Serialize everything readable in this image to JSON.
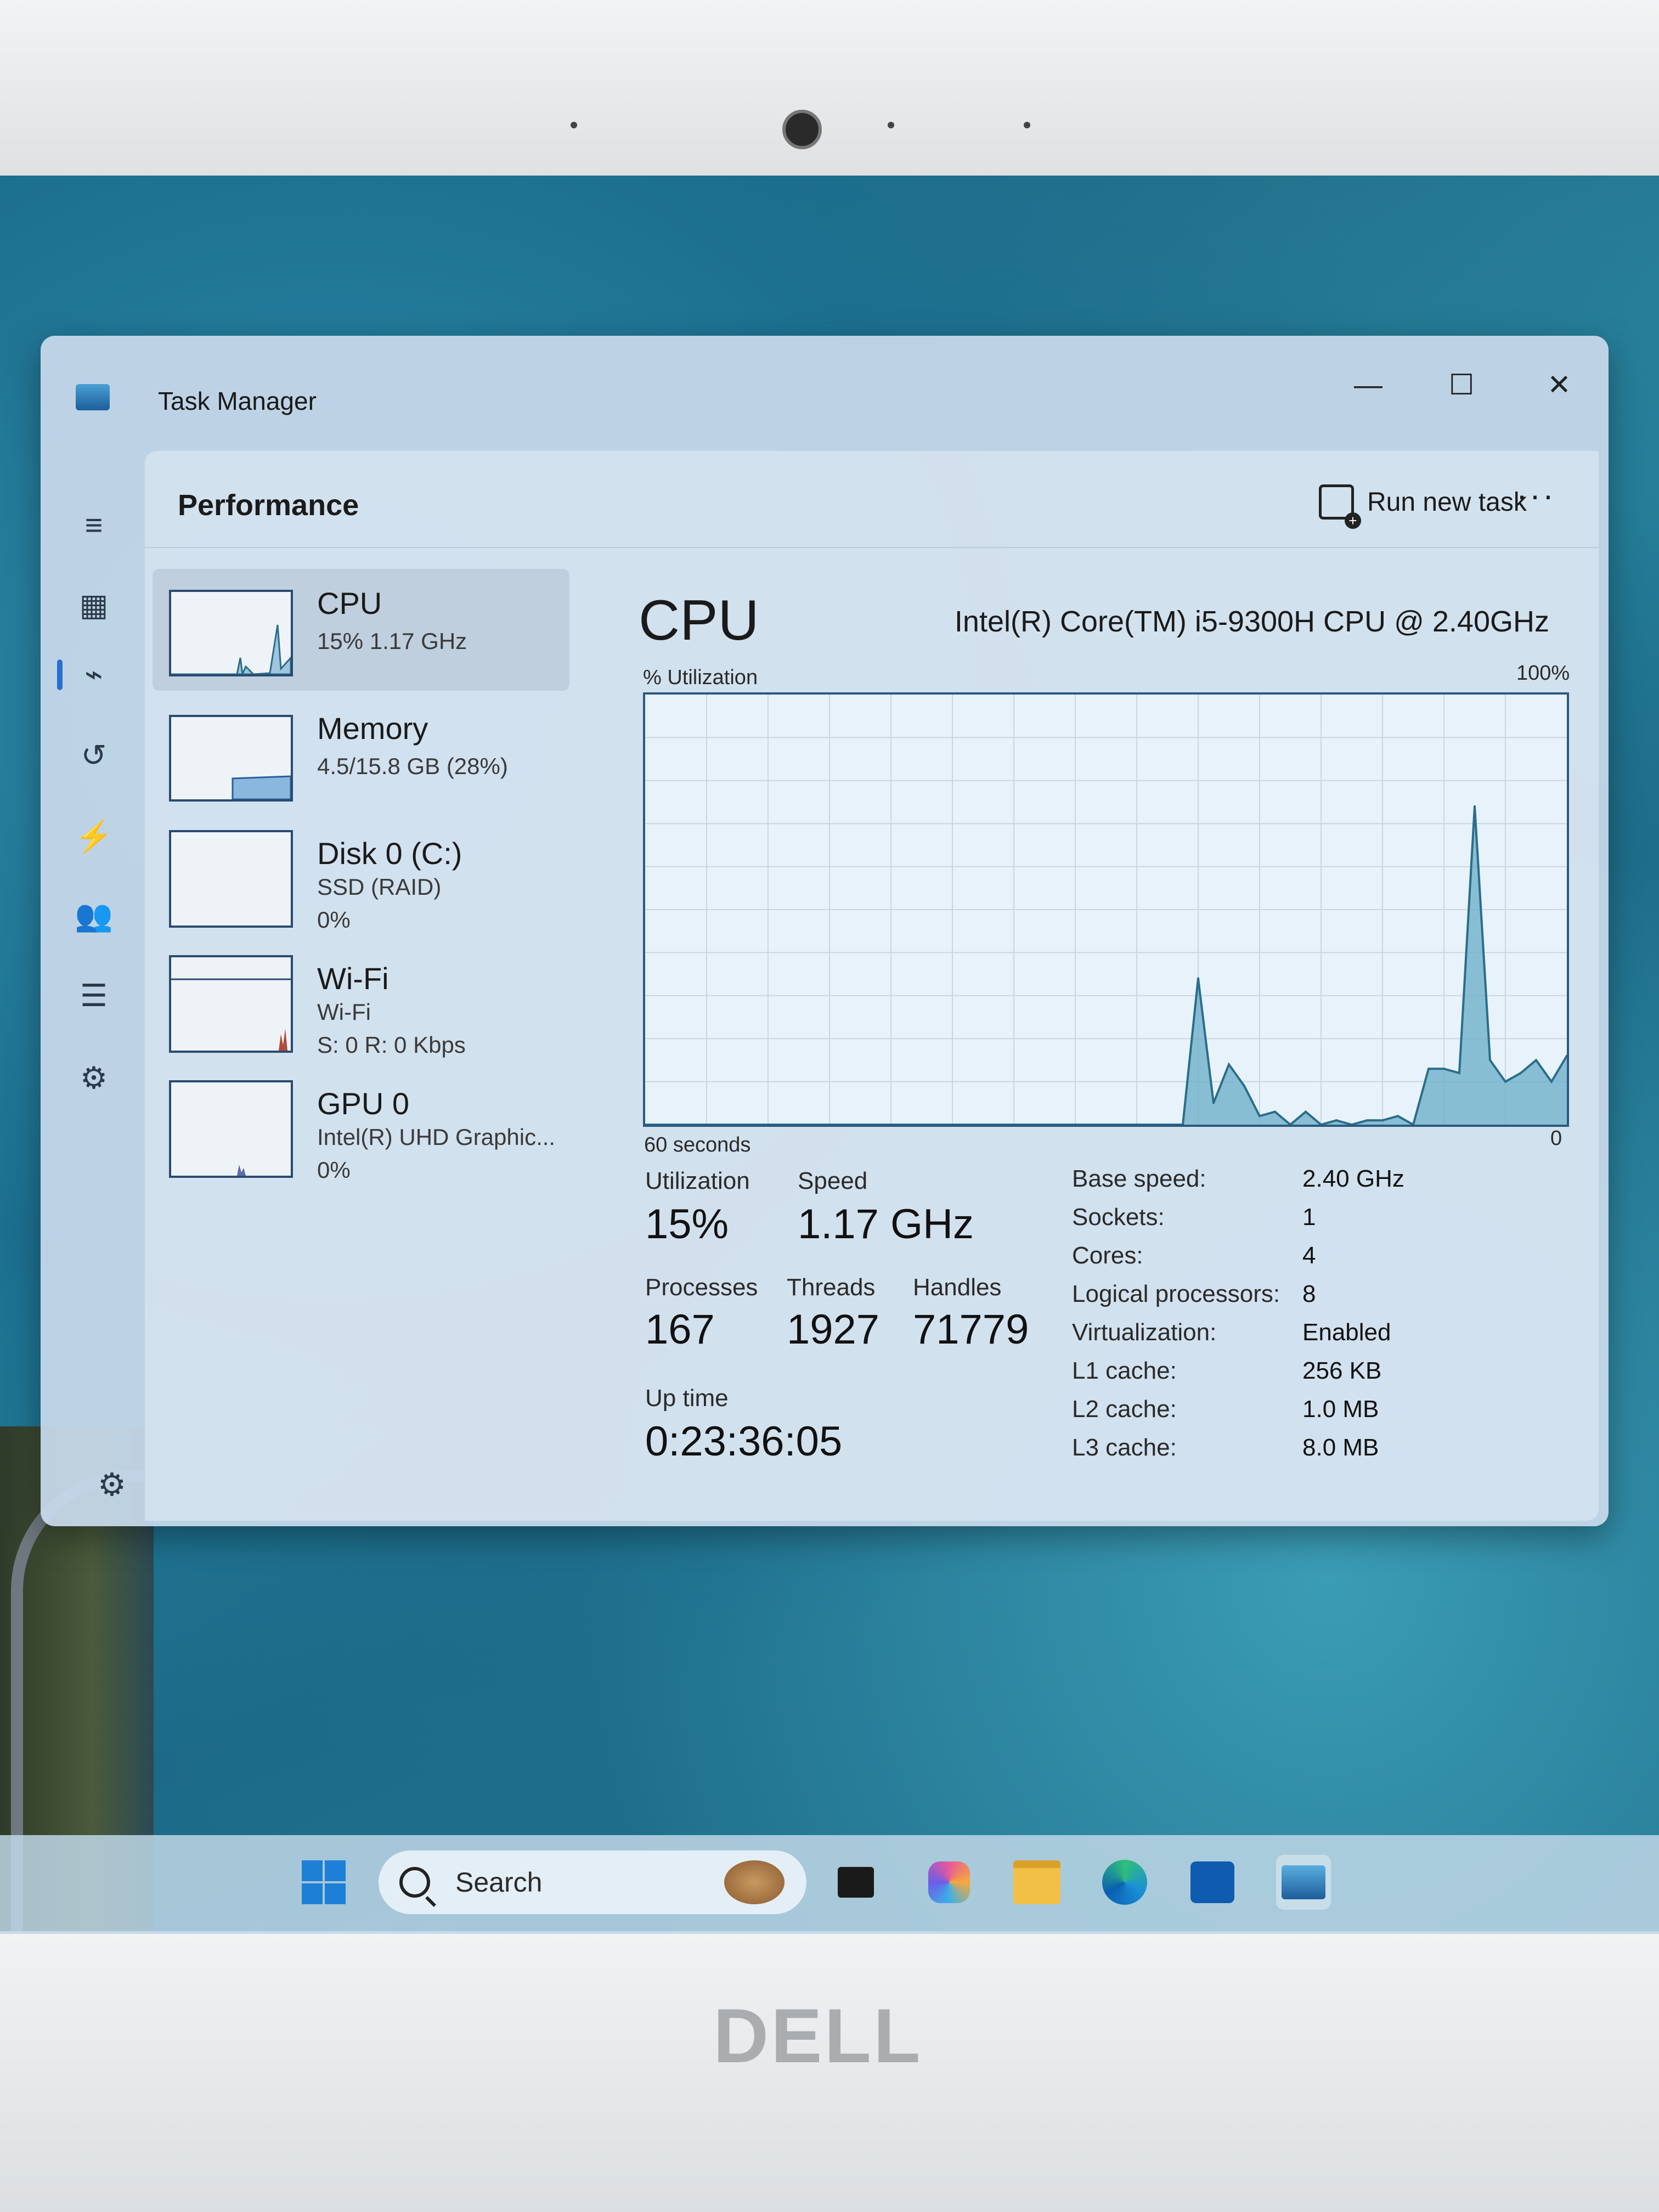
{
  "window": {
    "title": "Task Manager",
    "minimize": "—",
    "maximize": "☐",
    "close": "✕"
  },
  "header": {
    "page_title": "Performance",
    "run_new_task": "Run new task",
    "more": "···"
  },
  "rail": [
    "menu-icon",
    "processes-icon",
    "performance-icon",
    "app-history-icon",
    "startup-icon",
    "users-icon",
    "details-icon",
    "services-icon"
  ],
  "devices": [
    {
      "name": "CPU",
      "line1": "15%  1.17 GHz",
      "line2": ""
    },
    {
      "name": "Memory",
      "line1": "4.5/15.8 GB (28%)",
      "line2": ""
    },
    {
      "name": "Disk 0 (C:)",
      "line1": "SSD (RAID)",
      "line2": "0%"
    },
    {
      "name": "Wi-Fi",
      "line1": "Wi-Fi",
      "line2": "S: 0 R: 0 Kbps"
    },
    {
      "name": "GPU 0",
      "line1": "Intel(R) UHD Graphic...",
      "line2": "0%"
    }
  ],
  "cpu": {
    "title": "CPU",
    "model": "Intel(R) Core(TM) i5-9300H CPU @ 2.40GHz",
    "util_label": "% Utilization",
    "max_label": "100%",
    "time_label": "60 seconds",
    "zero_label": "0",
    "utilization_label": "Utilization",
    "utilization": "15%",
    "speed_label": "Speed",
    "speed": "1.17 GHz",
    "processes_label": "Processes",
    "processes": "167",
    "threads_label": "Threads",
    "threads": "1927",
    "handles_label": "Handles",
    "handles": "71779",
    "uptime_label": "Up time",
    "uptime": "0:23:36:05",
    "details": [
      {
        "k": "Base speed:",
        "v": "2.40 GHz"
      },
      {
        "k": "Sockets:",
        "v": "1"
      },
      {
        "k": "Cores:",
        "v": "4"
      },
      {
        "k": "Logical processors:",
        "v": "8"
      },
      {
        "k": "Virtualization:",
        "v": "Enabled"
      },
      {
        "k": "L1 cache:",
        "v": "256 KB"
      },
      {
        "k": "L2 cache:",
        "v": "1.0 MB"
      },
      {
        "k": "L3 cache:",
        "v": "8.0 MB"
      }
    ]
  },
  "chart_data": {
    "type": "area",
    "x": [
      0,
      1,
      2,
      3,
      4,
      5,
      6,
      7,
      8,
      9,
      10,
      11,
      12,
      13,
      14,
      15,
      16,
      17,
      18,
      19,
      20,
      21,
      22,
      23,
      24,
      25,
      26,
      27,
      28,
      29,
      30,
      31,
      32,
      33,
      34,
      35,
      36,
      37,
      38,
      39,
      40,
      41,
      42,
      43,
      44,
      45,
      46,
      47,
      48,
      49,
      50,
      51,
      52,
      53,
      54,
      55,
      56,
      57,
      58,
      59,
      60
    ],
    "values": [
      0,
      0,
      0,
      0,
      0,
      0,
      0,
      0,
      0,
      0,
      0,
      0,
      0,
      0,
      0,
      0,
      0,
      0,
      0,
      0,
      0,
      0,
      0,
      0,
      0,
      0,
      0,
      0,
      0,
      0,
      0,
      0,
      0,
      0,
      0,
      0,
      34,
      5,
      14,
      9,
      2,
      3,
      0,
      3,
      0,
      1,
      0,
      1,
      1,
      2,
      0,
      13,
      13,
      12,
      74,
      15,
      10,
      12,
      15,
      10,
      16
    ],
    "ylim": [
      0,
      100
    ],
    "color": "#6fb0c9",
    "line_color": "#2b6d8c",
    "grid": true
  },
  "taskbar": {
    "search": "Search",
    "items": [
      "start-icon",
      "search-icon",
      "task-view-icon",
      "copilot-icon",
      "file-explorer-icon",
      "edge-icon",
      "store-icon",
      "task-manager-icon"
    ]
  },
  "brand": "DELL"
}
